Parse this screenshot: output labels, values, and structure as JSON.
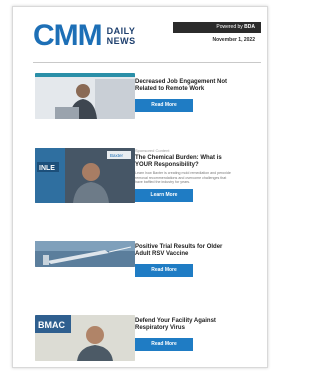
{
  "header": {
    "logo_mark": "CMM",
    "logo_line1": "DAILY",
    "logo_line2": "NEWS",
    "powered_prefix": "Powered by",
    "powered_brand": "BDA",
    "date": "November 1, 2022"
  },
  "articles": [
    {
      "eyebrow": "",
      "title": "Decreased Job Engagement Not Related to Remote Work",
      "description": "",
      "button": "Read More"
    },
    {
      "eyebrow": "Sponsored Content",
      "title": "The Chemical Burden: What is YOUR Responsibility?",
      "description": "Learn how Baxter is creating mold remediation and peroxide removal recommendations and overcome challenges that have baffled the industry for years.",
      "button": "Learn More",
      "thumb_badge": "INLE",
      "thumb_logo": "Baxter"
    },
    {
      "eyebrow": "",
      "title": "Positive Trial Results for Older Adult RSV Vaccine",
      "description": "",
      "button": "Read More"
    },
    {
      "eyebrow": "",
      "title": "Defend Your Facility Against Respiratory Virus",
      "description": "",
      "button": "Read More",
      "thumb_badge": "BMAC"
    }
  ],
  "colors": {
    "brand_blue": "#1d6fb6",
    "button_blue": "#1f7cc4",
    "powered_bar": "#2b2b2b"
  }
}
